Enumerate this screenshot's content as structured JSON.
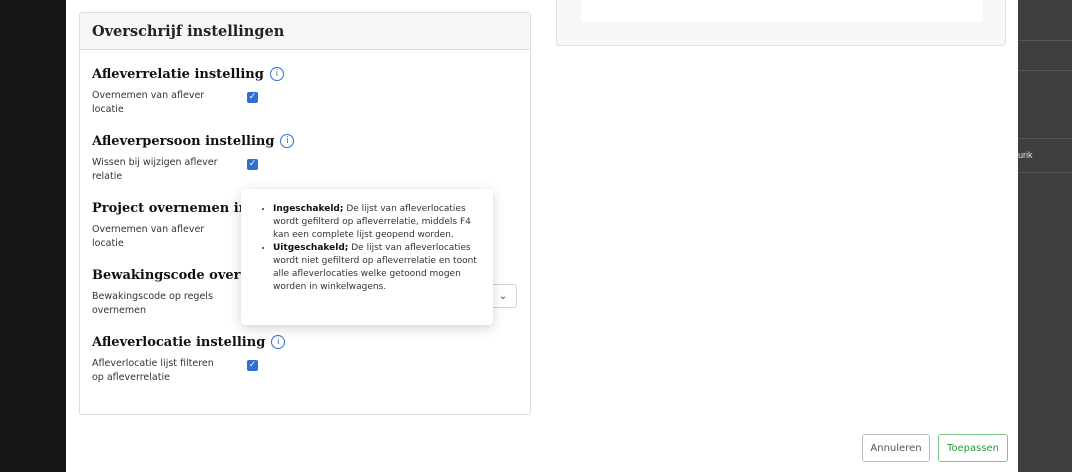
{
  "card": {
    "title": "Overschrijf instellingen",
    "settings": [
      {
        "title": "Afleverrelatie instelling",
        "desc": "Overnemen van aflever locatie",
        "control": "checkbox",
        "checked": true
      },
      {
        "title": "Afleverpersoon instelling",
        "desc": "Wissen bij wijzigen aflever relatie",
        "control": "checkbox",
        "checked": true
      },
      {
        "title": "Project overnemen instell",
        "desc": "Overnemen van aflever locatie",
        "control": "checkbox",
        "checked": true
      },
      {
        "title": "Bewakingscode overneme",
        "desc": "Bewakingscode op regels overnemen",
        "control": "select"
      },
      {
        "title": "Afleverlocatie instelling",
        "desc": "Afleverlocatie lijst filteren op afleverrelatie",
        "control": "checkbox",
        "checked": true
      }
    ]
  },
  "tooltip": {
    "items": [
      {
        "bold": "Ingeschakeld;",
        "text": " De lijst van afleverlocaties wordt gefilterd op afleverrelatie, middels F4 kan een complete lijst geopend worden."
      },
      {
        "bold": "Uitgeschakeld;",
        "text": " De lijst van afleverlocaties wordt niet gefilterd op afleverrelatie en toont alle afleverlocaties welke getoond mogen worden in winkelwagens."
      }
    ]
  },
  "buttons": {
    "cancel": "Annuleren",
    "apply": "Toepassen"
  },
  "background": {
    "overlay_text": "urik"
  },
  "icons": {
    "info": "info-circle-icon",
    "check": "checkmark-icon",
    "chevron": "chevron-down-icon"
  },
  "colors": {
    "accent": "#2f6fd1",
    "apply": "#2e9a3f"
  }
}
